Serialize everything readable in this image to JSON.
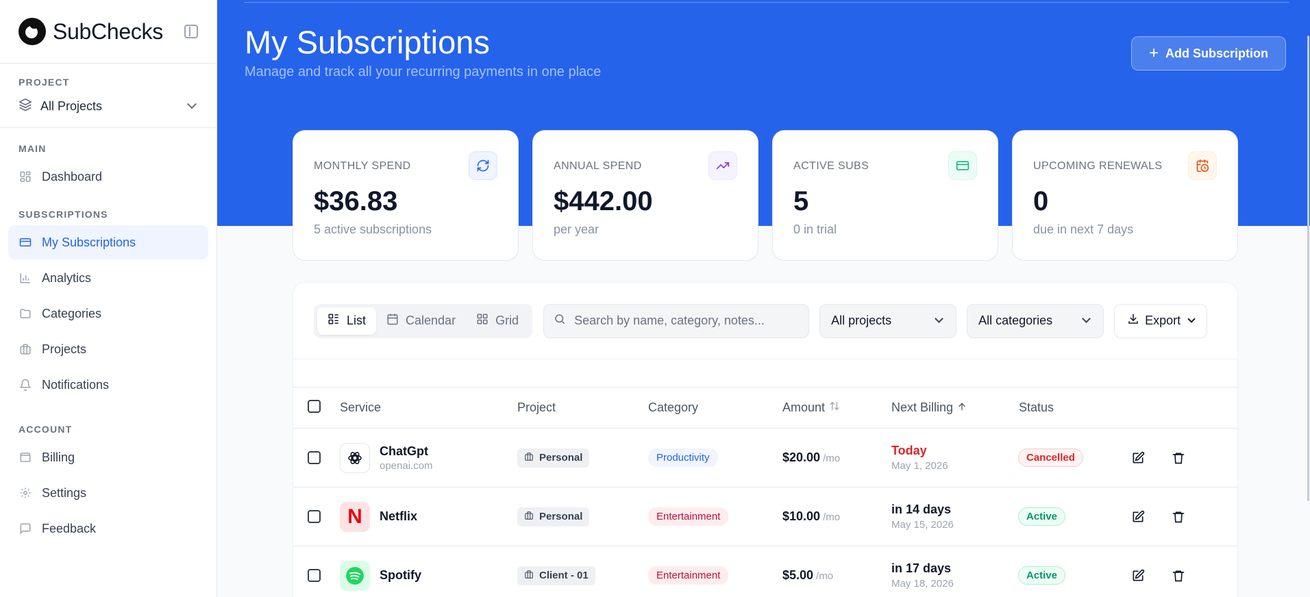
{
  "brand": {
    "name": "SubChecks"
  },
  "sidebar": {
    "project_label": "PROJECT",
    "project_value": "All Projects",
    "sections": {
      "main": "MAIN",
      "subscriptions": "SUBSCRIPTIONS",
      "account": "ACCOUNT"
    },
    "items": {
      "dashboard": "Dashboard",
      "my_subscriptions": "My Subscriptions",
      "analytics": "Analytics",
      "categories": "Categories",
      "projects": "Projects",
      "notifications": "Notifications",
      "billing": "Billing",
      "settings": "Settings",
      "feedback": "Feedback"
    }
  },
  "header": {
    "title": "My Subscriptions",
    "subtitle": "Manage and track all your recurring payments in one place",
    "add_button": "Add Subscription"
  },
  "stats": [
    {
      "label": "MONTHLY SPEND",
      "value": "$36.83",
      "sub": "5 active subscriptions",
      "icon": "refresh-icon",
      "color": "#2563eb",
      "bg": "#eff4ff"
    },
    {
      "label": "ANNUAL SPEND",
      "value": "$442.00",
      "sub": "per year",
      "icon": "trending-up-icon",
      "color": "#7c3aed",
      "bg": "#f5f3ff"
    },
    {
      "label": "ACTIVE SUBS",
      "value": "5",
      "sub": "0 in trial",
      "icon": "credit-card-icon",
      "color": "#10b981",
      "bg": "#ecfdf5"
    },
    {
      "label": "UPCOMING RENEWALS",
      "value": "0",
      "sub": "due in next 7 days",
      "icon": "calendar-clock-icon",
      "color": "#ea580c",
      "bg": "#fff7ed"
    }
  ],
  "toolbar": {
    "views": {
      "list": "List",
      "calendar": "Calendar",
      "grid": "Grid"
    },
    "search_placeholder": "Search by name, category, notes...",
    "projects_filter": "All projects",
    "categories_filter": "All categories",
    "export": "Export"
  },
  "table": {
    "headers": {
      "service": "Service",
      "project": "Project",
      "category": "Category",
      "amount": "Amount",
      "next_billing": "Next Billing",
      "status": "Status"
    },
    "rows": [
      {
        "name": "ChatGpt",
        "domain": "openai.com",
        "project": "Personal",
        "category": "Productivity",
        "amount": "$20.00",
        "period": "/mo",
        "next": "Today",
        "next_date": "May 1, 2026",
        "status": "Cancelled"
      },
      {
        "name": "Netflix",
        "domain": "",
        "project": "Personal",
        "category": "Entertainment",
        "amount": "$10.00",
        "period": "/mo",
        "next": "in 14 days",
        "next_date": "May 15, 2026",
        "status": "Active"
      },
      {
        "name": "Spotify",
        "domain": "",
        "project": "Client - 01",
        "category": "Entertainment",
        "amount": "$5.00",
        "period": "/mo",
        "next": "in 17 days",
        "next_date": "May 18, 2026",
        "status": "Active"
      }
    ]
  },
  "colors": {
    "primary": "#2563eb",
    "danger": "#dc2626",
    "success": "#059669"
  }
}
